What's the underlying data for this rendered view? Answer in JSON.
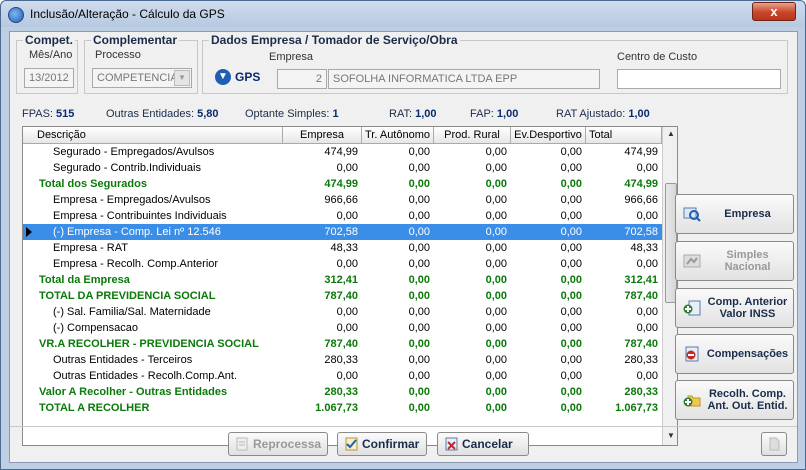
{
  "window": {
    "title": "Inclusão/Alteração - Cálculo da GPS",
    "close_label": "x"
  },
  "compet": {
    "title": "Compet.",
    "sub_label": "Mês/Ano",
    "value": "13/2012"
  },
  "complementar": {
    "title": "Complementar",
    "sub_label": "Processo",
    "value": "COMPETENCIA"
  },
  "dados": {
    "title": "Dados Empresa / Tomador de Serviço/Obra",
    "gps_label": "GPS",
    "empresa_label": "Empresa",
    "empresa_code": "2",
    "empresa_name": "SOFOLHA INFORMATICA LTDA EPP",
    "centro_label": "Centro de Custo",
    "centro_value": ""
  },
  "stats": {
    "fpas_label": "FPAS:",
    "fpas": "515",
    "outras_label": "Outras Entidades:",
    "outras": "5,80",
    "optante_label": "Optante Simples:",
    "optante": "1",
    "rat_label": "RAT:",
    "rat": "1,00",
    "fap_label": "FAP:",
    "fap": "1,00",
    "rat_aj_label": "RAT Ajustado:",
    "rat_aj": "1,00"
  },
  "grid": {
    "headers": [
      "Descrição",
      "Empresa",
      "Tr. Autônomo",
      "Prod. Rural",
      "Ev.Desportivo",
      "Total"
    ],
    "rows": [
      {
        "d": "Segurado - Empregados/Avulsos",
        "e": "474,99",
        "t": "0,00",
        "p": "0,00",
        "v": "0,00",
        "tot": "474,99",
        "kind": "item"
      },
      {
        "d": "Segurado - Contrib.Individuais",
        "e": "0,00",
        "t": "0,00",
        "p": "0,00",
        "v": "0,00",
        "tot": "0,00",
        "kind": "item"
      },
      {
        "d": "Total dos Segurados",
        "e": "474,99",
        "t": "0,00",
        "p": "0,00",
        "v": "0,00",
        "tot": "474,99",
        "kind": "total"
      },
      {
        "d": "Empresa -  Empregados/Avulsos",
        "e": "966,66",
        "t": "0,00",
        "p": "0,00",
        "v": "0,00",
        "tot": "966,66",
        "kind": "item"
      },
      {
        "d": "Empresa - Contribuintes Individuais",
        "e": "0,00",
        "t": "0,00",
        "p": "0,00",
        "v": "0,00",
        "tot": "0,00",
        "kind": "item"
      },
      {
        "d": "(-) Empresa - Comp. Lei nº 12.546",
        "e": "702,58",
        "t": "0,00",
        "p": "0,00",
        "v": "0,00",
        "tot": "702,58",
        "kind": "sel"
      },
      {
        "d": "Empresa - RAT",
        "e": "48,33",
        "t": "0,00",
        "p": "0,00",
        "v": "0,00",
        "tot": "48,33",
        "kind": "item"
      },
      {
        "d": "Empresa - Recolh. Comp.Anterior",
        "e": "0,00",
        "t": "0,00",
        "p": "0,00",
        "v": "0,00",
        "tot": "0,00",
        "kind": "item"
      },
      {
        "d": "Total da Empresa",
        "e": "312,41",
        "t": "0,00",
        "p": "0,00",
        "v": "0,00",
        "tot": "312,41",
        "kind": "total0"
      },
      {
        "d": "TOTAL DA PREVIDENCIA SOCIAL",
        "e": "787,40",
        "t": "0,00",
        "p": "0,00",
        "v": "0,00",
        "tot": "787,40",
        "kind": "total0"
      },
      {
        "d": "(-) Sal. Familia/Sal. Maternidade",
        "e": "0,00",
        "t": "0,00",
        "p": "0,00",
        "v": "0,00",
        "tot": "0,00",
        "kind": "item"
      },
      {
        "d": "(-) Compensacao",
        "e": "0,00",
        "t": "0,00",
        "p": "0,00",
        "v": "0,00",
        "tot": "0,00",
        "kind": "item"
      },
      {
        "d": "VR.A RECOLHER - PREVIDENCIA SOCIAL",
        "e": "787,40",
        "t": "0,00",
        "p": "0,00",
        "v": "0,00",
        "tot": "787,40",
        "kind": "total0"
      },
      {
        "d": "Outras Entidades - Terceiros",
        "e": "280,33",
        "t": "0,00",
        "p": "0,00",
        "v": "0,00",
        "tot": "280,33",
        "kind": "item"
      },
      {
        "d": "Outras Entidades - Recolh.Comp.Ant.",
        "e": "0,00",
        "t": "0,00",
        "p": "0,00",
        "v": "0,00",
        "tot": "0,00",
        "kind": "item"
      },
      {
        "d": "Valor A Recolher - Outras Entidades",
        "e": "280,33",
        "t": "0,00",
        "p": "0,00",
        "v": "0,00",
        "tot": "280,33",
        "kind": "total0"
      },
      {
        "d": "TOTAL A RECOLHER",
        "e": "1.067,73",
        "t": "0,00",
        "p": "0,00",
        "v": "0,00",
        "tot": "1.067,73",
        "kind": "total0"
      }
    ]
  },
  "side_buttons": {
    "empresa": "Empresa",
    "simples": "Simples Nacional",
    "comp_anterior": "Comp. Anterior Valor INSS",
    "compensacoes": "Compensações",
    "recolh": "Recolh. Comp. Ant. Out. Entid."
  },
  "bottom_buttons": {
    "reprocessa": "Reprocessa",
    "confirmar": "Confirmar",
    "cancelar": "Cancelar"
  },
  "colors": {
    "total_green": "#0a7a0a",
    "selection": "#3b8ee8"
  }
}
